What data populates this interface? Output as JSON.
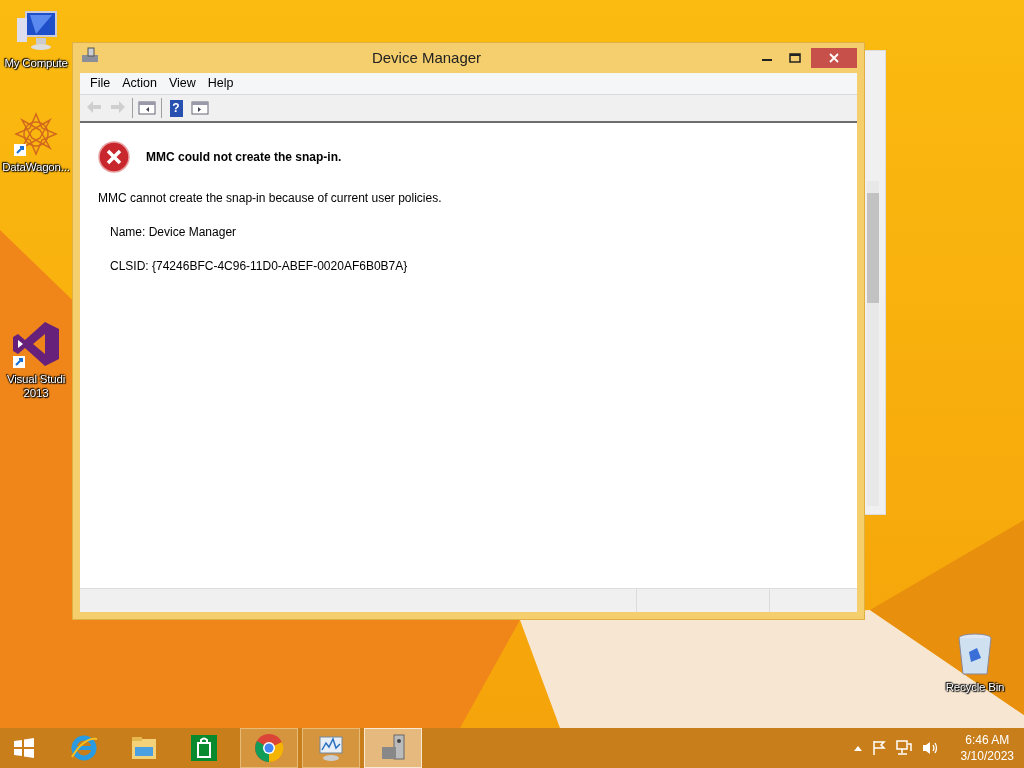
{
  "desktop_icons": [
    {
      "kind": "computer",
      "lines": [
        "My Compute"
      ]
    },
    {
      "kind": "datawagon",
      "lines": [
        "DataWagon..."
      ]
    },
    {
      "kind": "visualstudio",
      "lines": [
        "Visual Studi",
        "2013"
      ]
    },
    {
      "kind": "recyclebin",
      "lines": [
        "Recycle Bin"
      ]
    }
  ],
  "window": {
    "title": "Device Manager",
    "menu": [
      "File",
      "Action",
      "View",
      "Help"
    ],
    "toolbar": [
      {
        "kind": "back",
        "disabled": true
      },
      {
        "kind": "forward",
        "disabled": true
      },
      {
        "kind": "separator"
      },
      {
        "kind": "pane",
        "disabled": false
      },
      {
        "kind": "separator"
      },
      {
        "kind": "help",
        "disabled": false,
        "glyph": "?"
      },
      {
        "kind": "actionpane",
        "disabled": false
      }
    ],
    "error": {
      "heading": "MMC could not create the snap-in.",
      "message": "MMC cannot create the snap-in because of current user policies.",
      "details": [
        "Name: Device Manager",
        "CLSID: {74246BFC-4C96-11D0-ABEF-0020AF6B0B7A}"
      ]
    }
  },
  "taskbar": {
    "items": [
      {
        "kind": "start",
        "running": false,
        "selected": false
      },
      {
        "kind": "ie",
        "running": false,
        "selected": false
      },
      {
        "kind": "explorer",
        "running": false,
        "selected": false
      },
      {
        "kind": "store",
        "running": false,
        "selected": false
      },
      {
        "kind": "chrome",
        "running": true,
        "selected": false
      },
      {
        "kind": "perfmon",
        "running": true,
        "selected": false
      },
      {
        "kind": "devmgr",
        "running": true,
        "selected": true
      }
    ],
    "clock": {
      "time": "6:46 AM",
      "date": "3/10/2023"
    }
  }
}
